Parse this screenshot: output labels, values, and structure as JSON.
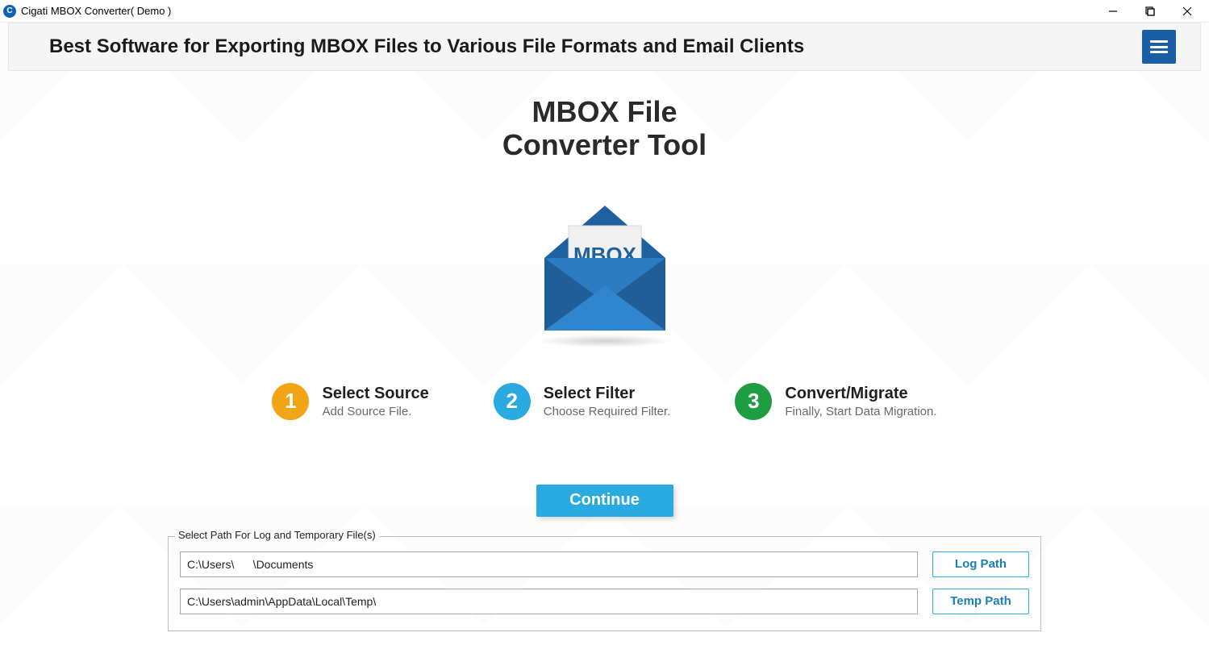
{
  "window": {
    "title": "Cigati MBOX Converter( Demo )"
  },
  "header": {
    "headline": "Best Software for Exporting MBOX Files to Various File Formats and Email Clients"
  },
  "hero": {
    "line1": "MBOX File",
    "line2": "Converter Tool",
    "badge": "MBOX"
  },
  "steps": [
    {
      "num": "1",
      "title": "Select Source",
      "sub": "Add Source File."
    },
    {
      "num": "2",
      "title": "Select Filter",
      "sub": "Choose Required Filter."
    },
    {
      "num": "3",
      "title": "Convert/Migrate",
      "sub": "Finally, Start Data Migration."
    }
  ],
  "actions": {
    "continue": "Continue"
  },
  "paths": {
    "legend": "Select Path For Log and Temporary File(s)",
    "log_value": "C:\\Users\\      \\Documents",
    "log_button": "Log Path",
    "temp_value": "C:\\Users\\admin\\AppData\\Local\\Temp\\",
    "temp_button": "Temp Path"
  },
  "colors": {
    "accent_blue": "#29abe2",
    "brand_blue": "#1a5ea3",
    "step_orange": "#f2a516",
    "step_green": "#1f9d43"
  }
}
